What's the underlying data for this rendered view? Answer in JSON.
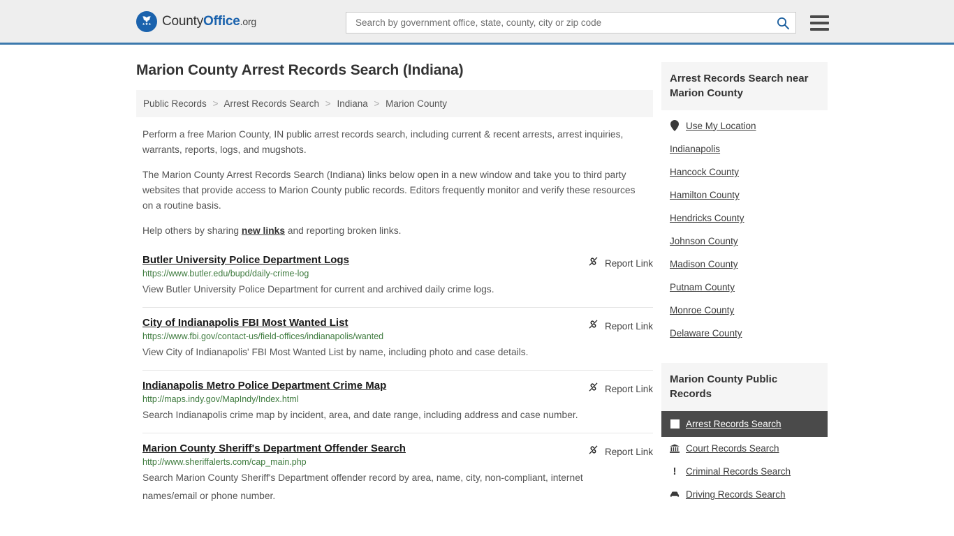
{
  "header": {
    "logo": {
      "part1": "County",
      "part2": "Office",
      "part3": ".org",
      "icon": "eagle-seal-icon"
    },
    "search": {
      "placeholder": "Search by government office, state, county, city or zip code",
      "value": "",
      "icon": "search-icon"
    },
    "menu_icon": "hamburger-menu-icon",
    "accent_color": "#3c79ad"
  },
  "page_title": "Marion County Arrest Records Search (Indiana)",
  "breadcrumb": {
    "separator": ">",
    "items": [
      "Public Records",
      "Arrest Records Search",
      "Indiana",
      "Marion County"
    ]
  },
  "intro": {
    "paragraph1": "Perform a free Marion County, IN public arrest records search, including current & recent arrests, arrest inquiries, warrants, reports, logs, and mugshots.",
    "paragraph2": "The Marion County Arrest Records Search (Indiana) links below open in a new window and take you to third party websites that provide access to Marion County public records. Editors frequently monitor and verify these resources on a routine basis.",
    "paragraph3_before": "Help others by sharing ",
    "paragraph3_link": "new links",
    "paragraph3_after": " and reporting broken links."
  },
  "report_link_label": "Report Link",
  "report_link_icon": "broken-link-icon",
  "results": [
    {
      "title": "Butler University Police Department Logs",
      "url": "https://www.butler.edu/bupd/daily-crime-log",
      "description": "View Butler University Police Department for current and archived daily crime logs."
    },
    {
      "title": "City of Indianapolis FBI Most Wanted List",
      "url": "https://www.fbi.gov/contact-us/field-offices/indianapolis/wanted",
      "description": "View City of Indianapolis' FBI Most Wanted List by name, including photo and case details."
    },
    {
      "title": "Indianapolis Metro Police Department Crime Map",
      "url": "http://maps.indy.gov/MapIndy/Index.html",
      "description": "Search Indianapolis crime map by incident, area, and date range, including address and case number."
    },
    {
      "title": "Marion County Sheriff's Department Offender Search",
      "url": "http://www.sheriffalerts.com/cap_main.php",
      "description": "Search Marion County Sheriff's Department offender record by area, name, city, non-compliant, internet names/email or phone number."
    }
  ],
  "sidebar": {
    "nearby": {
      "heading": "Arrest Records Search near Marion County",
      "items": [
        {
          "label": "Use My Location",
          "icon": "map-pin-icon"
        },
        {
          "label": "Indianapolis",
          "icon": ""
        },
        {
          "label": "Hancock County",
          "icon": ""
        },
        {
          "label": "Hamilton County",
          "icon": ""
        },
        {
          "label": "Hendricks County",
          "icon": ""
        },
        {
          "label": "Johnson County",
          "icon": ""
        },
        {
          "label": "Madison County",
          "icon": ""
        },
        {
          "label": "Putnam County",
          "icon": ""
        },
        {
          "label": "Monroe County",
          "icon": ""
        },
        {
          "label": "Delaware County",
          "icon": ""
        }
      ]
    },
    "records": {
      "heading": "Marion County Public Records",
      "items": [
        {
          "label": "Arrest Records Search",
          "icon": "square-icon",
          "active": true
        },
        {
          "label": "Court Records Search",
          "icon": "courthouse-icon",
          "active": false
        },
        {
          "label": "Criminal Records Search",
          "icon": "exclamation-icon",
          "active": false
        },
        {
          "label": "Driving Records Search",
          "icon": "car-icon",
          "active": false
        }
      ]
    }
  }
}
